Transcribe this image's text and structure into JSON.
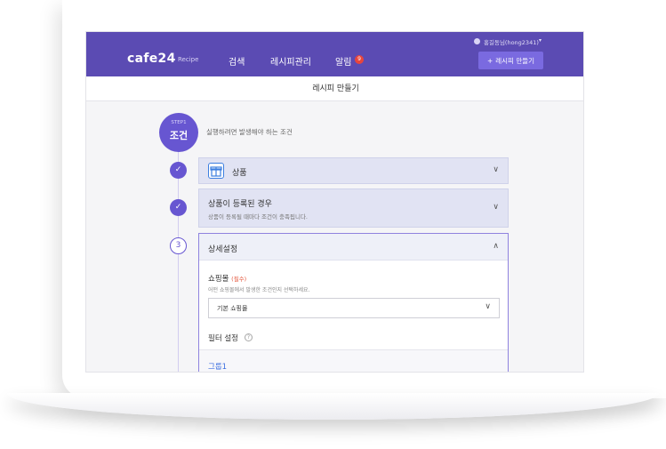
{
  "header": {
    "logo": "cafe24",
    "logo_sub": "Recipe",
    "nav": [
      "검색",
      "레시피관리",
      "알림"
    ],
    "notification_count": "9",
    "user": "홍길동님(hong2341)",
    "make_button": "레시피 만들기"
  },
  "page": {
    "title": "레시피 만들기"
  },
  "step": {
    "label": "STEP1",
    "title": "조건",
    "description": "실행하려면 발생해야 하는 조건"
  },
  "cards": {
    "product": {
      "title": "상품"
    },
    "registered": {
      "title": "상품이 등록된 경우",
      "subtitle": "상품이 등록될 때마다 조건이 충족됩니다."
    },
    "detail": {
      "number": "3",
      "title": "상세설정",
      "field_label": "쇼핑몰",
      "required": "(필수)",
      "field_help": "어떤 쇼핑몰에서 발생한 조건인지 선택하세요.",
      "select_value": "기본 쇼핑몰",
      "filter_label": "필터 설정",
      "group_label": "그룹1"
    }
  },
  "colors": {
    "brand": "#5b4bb3",
    "accent": "#6756d1",
    "link": "#3d6fe0",
    "required": "#e4573d"
  }
}
